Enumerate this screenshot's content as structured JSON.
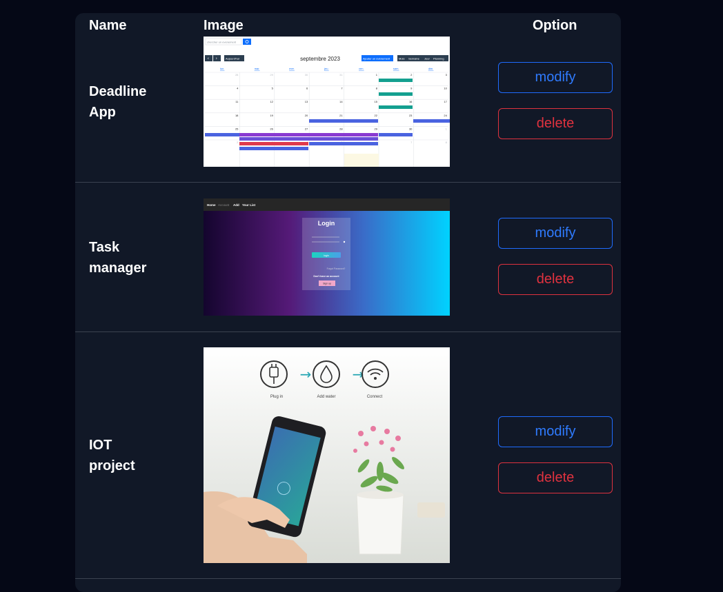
{
  "table": {
    "headers": {
      "name": "Name",
      "image": "Image",
      "option": "Option"
    },
    "rows": [
      {
        "name_line1": "Deadline",
        "name_line2": "App",
        "modify_label": "modify",
        "delete_label": "delete",
        "thumbnail": {
          "kind": "calendar-screenshot",
          "search_placeholder": "chercher un evenement",
          "today_label": "Aujourd'hui",
          "month_title": "septembre 2023",
          "add_event_label": "Ajouter un évènement",
          "view_buttons": [
            "Mois",
            "Semaine",
            "Jour",
            "Planning"
          ],
          "weekdays": [
            "lun.",
            "mar.",
            "mer.",
            "jeu.",
            "ven.",
            "sam.",
            "dim."
          ],
          "weeks": [
            [
              "28",
              "29",
              "30",
              "31",
              "1",
              "2",
              "3"
            ],
            [
              "4",
              "5",
              "6",
              "7",
              "8",
              "9",
              "10"
            ],
            [
              "11",
              "12",
              "13",
              "14",
              "15",
              "16",
              "17"
            ],
            [
              "18",
              "19",
              "20",
              "21",
              "22",
              "23",
              "24"
            ],
            [
              "25",
              "26",
              "27",
              "28",
              "29",
              "30",
              "1"
            ],
            [
              "2",
              "3",
              "4",
              "5",
              "6",
              "7",
              "8"
            ]
          ]
        }
      },
      {
        "name_line1": "Task",
        "name_line2": "manager",
        "modify_label": "modify",
        "delete_label": "delete",
        "thumbnail": {
          "kind": "login-screenshot",
          "nav_items": [
            "Home",
            "Account",
            "Add",
            "Your List"
          ],
          "login_title": "Login",
          "login_button": "login",
          "forgot_label": "Forgot Password?",
          "no_account_label": "Don't have an account",
          "signup_button": "Sign up"
        }
      },
      {
        "name_line1": "IOT",
        "name_line2": "project",
        "modify_label": "modify",
        "delete_label": "delete",
        "thumbnail": {
          "kind": "iot-photo",
          "steps": [
            "Plug in",
            "Add water",
            "Connect"
          ]
        }
      }
    ]
  },
  "colors": {
    "page_bg": "#050816",
    "panel_bg": "#111827",
    "modify_blue": "#2f7bff",
    "delete_red": "#e0323f",
    "divider": "#3b4250"
  }
}
